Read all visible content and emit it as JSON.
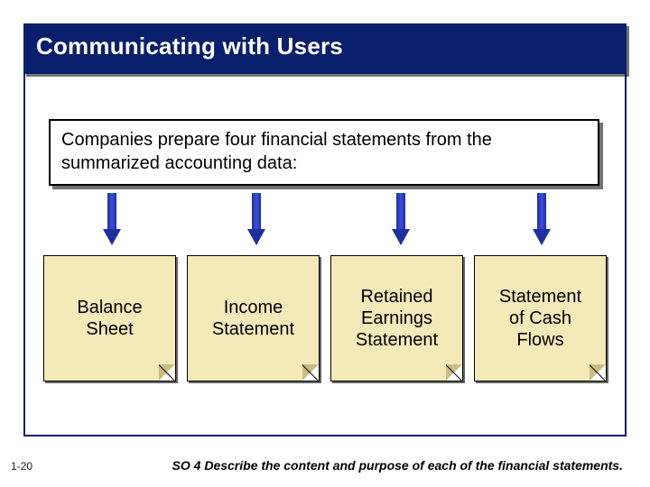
{
  "title": "Communicating with Users",
  "info_text": "Companies prepare four financial statements from the summarized accounting data:",
  "cards": [
    {
      "label": "Balance\nSheet"
    },
    {
      "label": "Income\nStatement"
    },
    {
      "label": "Retained\nEarnings\nStatement"
    },
    {
      "label": "Statement\nof Cash\nFlows"
    }
  ],
  "page_number": "1-20",
  "footer": "SO 4  Describe the content and purpose of each of the financial statements."
}
